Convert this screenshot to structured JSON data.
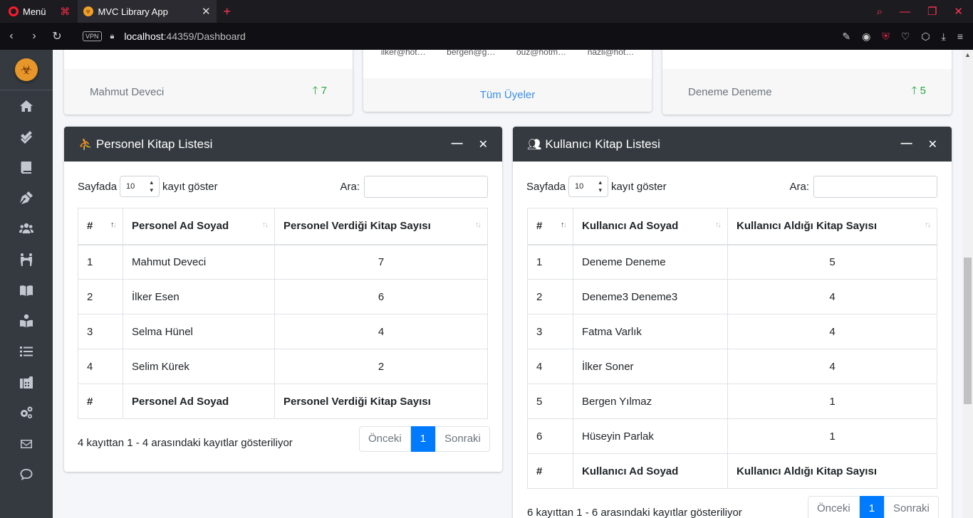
{
  "browser": {
    "menu_label": "Menü",
    "tab_title": "MVC Library App",
    "vpn_label": "VPN",
    "url_host": "localhost",
    "url_rest": ":44359/Dashboard"
  },
  "sidebar": {
    "items": [
      {
        "icon": "home-icon"
      },
      {
        "icon": "check-double-icon"
      },
      {
        "icon": "book-icon"
      },
      {
        "icon": "pen-nib-icon"
      },
      {
        "icon": "users-icon"
      },
      {
        "icon": "people-carry-icon"
      },
      {
        "icon": "book-open-icon"
      },
      {
        "icon": "book-reader-icon"
      },
      {
        "icon": "list-icon"
      },
      {
        "icon": "fax-icon"
      },
      {
        "icon": "cogs-icon"
      },
      {
        "icon": "envelope-icon"
      },
      {
        "icon": "comment-icon"
      }
    ]
  },
  "top_cards": {
    "left": {
      "name": "Mahmut Deveci",
      "trend": "7"
    },
    "middle": {
      "emails": [
        "ilker@hot…",
        "bergen@g…",
        "ouz@hotm…",
        "nazli@hot…"
      ],
      "link": "Tüm Üyeler"
    },
    "right": {
      "name": "Deneme Deneme",
      "trend": "5"
    }
  },
  "staff_panel": {
    "title": "Personel Kitap Listesi",
    "show_prefix": "Sayfada",
    "page_size": "10",
    "show_suffix": "kayıt göster",
    "search_label": "Ara:",
    "columns": [
      "#",
      "Personel Ad Soyad",
      "Personel Verdiği Kitap Sayısı"
    ],
    "rows": [
      [
        "1",
        "Mahmut Deveci",
        "7"
      ],
      [
        "2",
        "İlker Esen",
        "6"
      ],
      [
        "3",
        "Selma Hünel",
        "4"
      ],
      [
        "4",
        "Selim Kürek",
        "2"
      ]
    ],
    "info": "4 kayıttan 1 - 4 arasındaki kayıtlar gösteriliyor",
    "prev": "Önceki",
    "page": "1",
    "next": "Sonraki"
  },
  "user_panel": {
    "title": "Kullanıcı Kitap Listesi",
    "show_prefix": "Sayfada",
    "page_size": "10",
    "show_suffix": "kayıt göster",
    "search_label": "Ara:",
    "columns": [
      "#",
      "Kullanıcı Ad Soyad",
      "Kullanıcı Aldığı Kitap Sayısı"
    ],
    "rows": [
      [
        "1",
        "Deneme Deneme",
        "5"
      ],
      [
        "2",
        "Deneme3 Deneme3",
        "4"
      ],
      [
        "3",
        "Fatma Varlık",
        "4"
      ],
      [
        "4",
        "İlker Soner",
        "4"
      ],
      [
        "5",
        "Bergen Yılmaz",
        "1"
      ],
      [
        "6",
        "Hüseyin Parlak",
        "1"
      ]
    ],
    "info": "6 kayıttan 1 - 6 arasındaki kayıtlar gösteriliyor",
    "prev": "Önceki",
    "page": "1",
    "next": "Sonraki"
  },
  "colors": {
    "sidebar_bg": "#343a40",
    "accent_blue": "#007bff",
    "trend_green": "#28a745"
  }
}
